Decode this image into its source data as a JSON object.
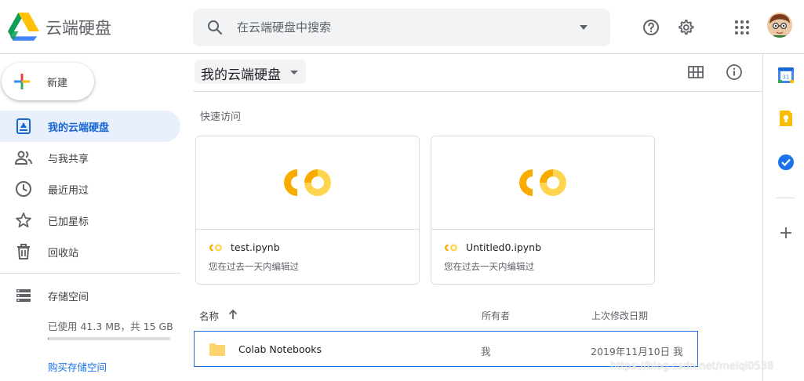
{
  "header": {
    "app_title": "云端硬盘",
    "search_placeholder": "在云端硬盘中搜索",
    "icons": [
      "drive-logo",
      "search-icon",
      "chevron-down-icon",
      "help-icon",
      "gear-icon",
      "apps-grid-icon",
      "avatar"
    ]
  },
  "sidebar": {
    "new_label": "新建",
    "items": [
      {
        "label": "我的云端硬盘",
        "icon": "my-drive-icon",
        "active": true
      },
      {
        "label": "与我共享",
        "icon": "people-icon",
        "active": false
      },
      {
        "label": "最近用过",
        "icon": "clock-icon",
        "active": false
      },
      {
        "label": "已加星标",
        "icon": "star-icon",
        "active": false
      },
      {
        "label": "回收站",
        "icon": "trash-icon",
        "active": false
      },
      {
        "label": "存储空间",
        "icon": "storage-icon",
        "active": false
      }
    ],
    "storage_usage": "已使用 41.3 MB，共 15 GB",
    "storage_used_fraction": 0.003,
    "buy_storage_label": "购买存储空间"
  },
  "main": {
    "breadcrumb": "我的云端硬盘",
    "quick_access_title": "快速访问",
    "quick_access": [
      {
        "name": "test.ipynb",
        "desc": "您在过去一天内编辑过"
      },
      {
        "name": "Untitled0.ipynb",
        "desc": "您在过去一天内编辑过"
      }
    ],
    "columns": {
      "name": "名称",
      "owner": "所有者",
      "modified": "上次修改日期"
    },
    "files": [
      {
        "name": "Colab Notebooks",
        "owner": "我",
        "modified": "2019年11月10日 我",
        "type": "folder"
      }
    ]
  },
  "side_panel": {
    "apps": [
      "calendar-icon",
      "keep-icon",
      "tasks-icon",
      "add-icon"
    ]
  },
  "watermark": "https://blog.csdn.net/meiqi0538",
  "colors": {
    "accent": "#1a73e8",
    "active_bg": "#e8f0fe",
    "colab_orange": "#f9ab00",
    "colab_yellow": "#ffd54f",
    "folder": "#fcd36c"
  }
}
